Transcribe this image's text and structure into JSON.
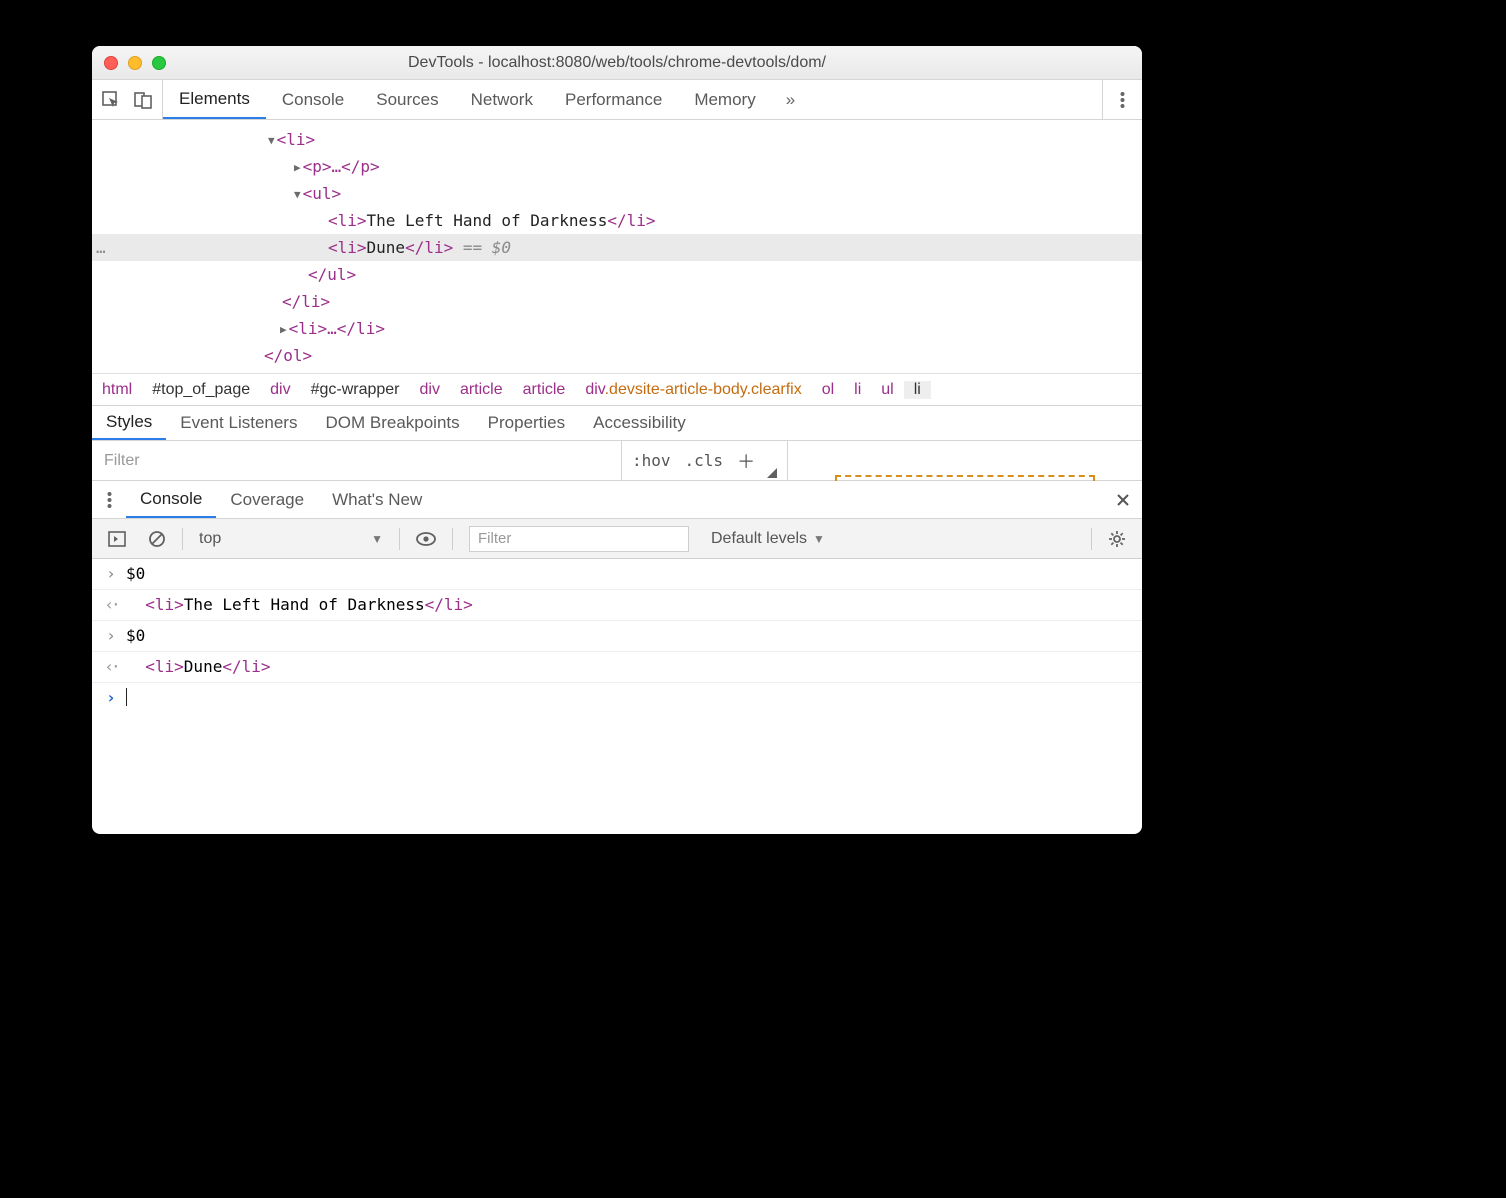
{
  "window": {
    "title": "DevTools - localhost:8080/web/tools/chrome-devtools/dom/"
  },
  "main_tabs": {
    "items": [
      "Elements",
      "Console",
      "Sources",
      "Network",
      "Performance",
      "Memory"
    ],
    "active_index": 0,
    "overflow_glyph": "»"
  },
  "elements_tree": {
    "lines": [
      {
        "indent": 176,
        "kind": "open",
        "html": "<li>"
      },
      {
        "indent": 202,
        "kind": "closed",
        "html": "<p>…</p>"
      },
      {
        "indent": 202,
        "kind": "open",
        "html": "<ul>"
      },
      {
        "indent": 236,
        "kind": "leaf",
        "open": "<li>",
        "text": "The Left Hand of Darkness",
        "close": "</li>"
      },
      {
        "indent": 236,
        "kind": "leaf",
        "selected": true,
        "open": "<li>",
        "text": "Dune",
        "close": "</li>",
        "suffix": " == $0"
      },
      {
        "indent": 216,
        "kind": "end",
        "html": "</ul>"
      },
      {
        "indent": 190,
        "kind": "end",
        "html": "</li>"
      },
      {
        "indent": 188,
        "kind": "closed",
        "html": "<li>…</li>"
      },
      {
        "indent": 172,
        "kind": "end",
        "html": "</ol>"
      }
    ]
  },
  "breadcrumb": [
    {
      "label": "html",
      "type": "tag"
    },
    {
      "label": "#top_of_page",
      "type": "id"
    },
    {
      "label": "div",
      "type": "tag"
    },
    {
      "label": "#gc-wrapper",
      "type": "id"
    },
    {
      "label": "div",
      "type": "tag"
    },
    {
      "label": "article",
      "type": "tag"
    },
    {
      "label": "article",
      "type": "tag"
    },
    {
      "label": "div",
      "cls": ".devsite-article-body.clearfix",
      "type": "tagcls"
    },
    {
      "label": "ol",
      "type": "tag"
    },
    {
      "label": "li",
      "type": "tag"
    },
    {
      "label": "ul",
      "type": "tag"
    },
    {
      "label": "li",
      "type": "last"
    }
  ],
  "sub_tabs": {
    "items": [
      "Styles",
      "Event Listeners",
      "DOM Breakpoints",
      "Properties",
      "Accessibility"
    ],
    "active_index": 0
  },
  "styles": {
    "filter_placeholder": "Filter",
    "hov": ":hov",
    "cls": ".cls"
  },
  "drawer_tabs": {
    "items": [
      "Console",
      "Coverage",
      "What's New"
    ],
    "active_index": 0
  },
  "console_toolbar": {
    "context": "top",
    "filter_placeholder": "Filter",
    "levels": "Default levels"
  },
  "console_log": [
    {
      "kind": "in",
      "text": "$0"
    },
    {
      "kind": "out",
      "open": "<li>",
      "text": "The Left Hand of Darkness",
      "close": "</li>",
      "indent": true
    },
    {
      "kind": "in",
      "text": "$0"
    },
    {
      "kind": "out",
      "open": "<li>",
      "text": "Dune",
      "close": "</li>",
      "indent": true
    },
    {
      "kind": "prompt"
    }
  ]
}
